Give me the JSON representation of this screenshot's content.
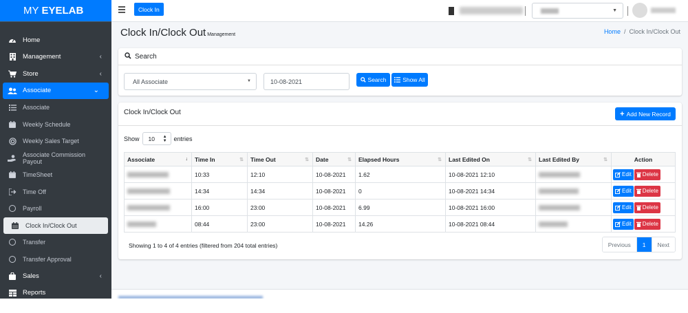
{
  "brand": {
    "prefix": "MY",
    "name": "EYELAB"
  },
  "topbar": {
    "clock_in_label": "Clock In"
  },
  "sidebar": {
    "items": [
      {
        "label": "Home",
        "icon": "dashboard-icon",
        "type": "main"
      },
      {
        "label": "Management",
        "icon": "building-icon",
        "type": "main",
        "chevron": "‹"
      },
      {
        "label": "Store",
        "icon": "cart-icon",
        "type": "main",
        "chevron": "‹"
      },
      {
        "label": "Associate",
        "icon": "users-icon",
        "type": "main",
        "chevron": "⌄",
        "active": true
      },
      {
        "label": "Associate",
        "icon": "list-icon",
        "type": "child"
      },
      {
        "label": "Weekly Schedule",
        "icon": "calendar-icon",
        "type": "child"
      },
      {
        "label": "Weekly Sales Target",
        "icon": "target-icon",
        "type": "child"
      },
      {
        "label": "Associate Commission Payout",
        "icon": "hand-coin-icon",
        "type": "child"
      },
      {
        "label": "TimeSheet",
        "icon": "calendar-icon",
        "type": "child"
      },
      {
        "label": "Time Off",
        "icon": "logout-icon",
        "type": "child"
      },
      {
        "label": "Payroll",
        "icon": "circle-icon",
        "type": "child"
      },
      {
        "label": "Clock In/Clock Out",
        "icon": "calendar-icon",
        "type": "child",
        "current": true
      },
      {
        "label": "Transfer",
        "icon": "circle-icon",
        "type": "child"
      },
      {
        "label": "Transfer Approval",
        "icon": "circle-icon",
        "type": "child"
      },
      {
        "label": "Sales",
        "icon": "bag-icon",
        "type": "main",
        "chevron": "‹"
      },
      {
        "label": "Reports",
        "icon": "table-icon",
        "type": "main"
      }
    ]
  },
  "header": {
    "title": "Clock In/Clock Out",
    "subtitle": "Management",
    "breadcrumb_home": "Home",
    "breadcrumb_current": "Clock In/Clock Out"
  },
  "search": {
    "title": "Search",
    "associate_value": "All Associate",
    "date_value": "10-08-2021",
    "search_label": "Search",
    "show_all_label": "Show All"
  },
  "records": {
    "title": "Clock In/Clock Out",
    "add_label": "Add New Record",
    "show_label": "Show",
    "entries_value": "10",
    "entries_label": "entries",
    "columns": [
      "Associate",
      "Time In",
      "Time Out",
      "Date",
      "Elapsed Hours",
      "Last Edited On",
      "Last Edited By",
      "Action"
    ],
    "rows": [
      {
        "time_in": "10:33",
        "time_out": "12:10",
        "date": "10-08-2021",
        "elapsed": "1.62",
        "edited_on": "10-08-2021 12:10"
      },
      {
        "time_in": "14:34",
        "time_out": "14:34",
        "date": "10-08-2021",
        "elapsed": "0",
        "edited_on": "10-08-2021 14:34"
      },
      {
        "time_in": "16:00",
        "time_out": "23:00",
        "date": "10-08-2021",
        "elapsed": "6.99",
        "edited_on": "10-08-2021 16:00"
      },
      {
        "time_in": "08:44",
        "time_out": "23:00",
        "date": "10-08-2021",
        "elapsed": "14.26",
        "edited_on": "10-08-2021 08:44"
      }
    ],
    "edit_label": "Edit",
    "delete_label": "Delete",
    "info": "Showing 1 to 4 of 4 entries (filtered from 204 total entries)",
    "pager": {
      "previous": "Previous",
      "current": "1",
      "next": "Next"
    }
  },
  "colors": {
    "primary": "#007bff",
    "danger": "#dc3545",
    "sidebar": "#343a40"
  }
}
